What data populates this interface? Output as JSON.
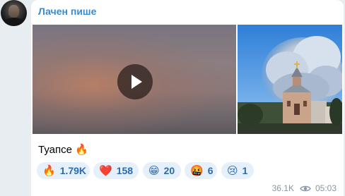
{
  "channel": {
    "name": "Лачен пише"
  },
  "media": {
    "video": {
      "play_label": ""
    },
    "photo": {}
  },
  "post": {
    "caption": "Туапсе 🔥"
  },
  "reactions": [
    {
      "emoji": "🔥",
      "count": "1.79K"
    },
    {
      "emoji": "❤️",
      "count": "158"
    },
    {
      "emoji": "😁",
      "count": "20"
    },
    {
      "emoji": "🤬",
      "count": "6"
    },
    {
      "emoji": "😢",
      "count": "1"
    }
  ],
  "meta": {
    "views": "36.1K",
    "time": "05:03"
  },
  "colors": {
    "accent": "#3a8cd0",
    "reaction_bg": "#e6f0fa",
    "reaction_text": "#2a6bb0",
    "background": "#e7edf1"
  }
}
